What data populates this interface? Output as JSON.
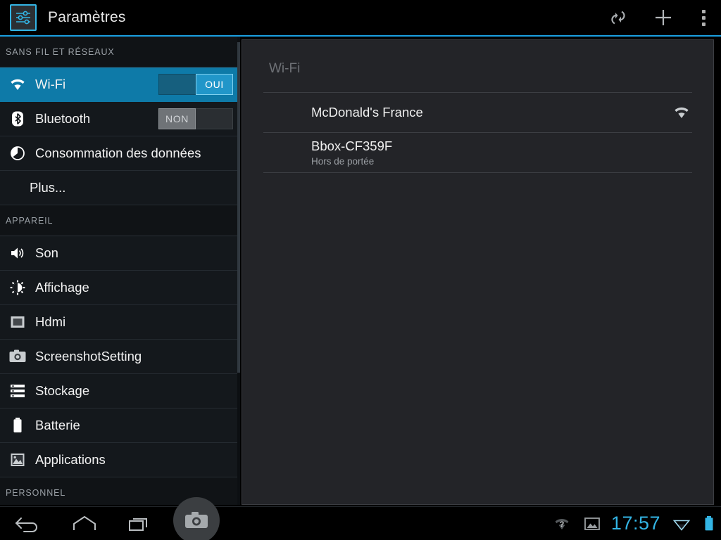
{
  "app": {
    "title": "Paramètres",
    "icon": "settings-sliders-icon",
    "accent_color": "#33b5e5",
    "selected_row_color": "#0e7aa8"
  },
  "action_bar": {
    "buttons": [
      {
        "name": "scan-refresh-button",
        "icon": "refresh-scan-icon",
        "label": ""
      },
      {
        "name": "add-network-button",
        "icon": "plus-icon",
        "label": ""
      },
      {
        "name": "overflow-menu-button",
        "icon": "overflow-menu-icon",
        "label": ""
      }
    ]
  },
  "sidebar": {
    "sections": [
      {
        "header": "SANS FIL ET RÉSEAUX",
        "items": [
          {
            "label": "Wi-Fi",
            "icon": "wifi-icon",
            "selected": true,
            "toggle": {
              "state": "on",
              "label": "OUI"
            }
          },
          {
            "label": "Bluetooth",
            "icon": "bluetooth-icon",
            "selected": false,
            "toggle": {
              "state": "off",
              "label": "NON"
            }
          },
          {
            "label": "Consommation des données",
            "icon": "data-usage-pie-icon",
            "selected": false
          },
          {
            "label": "Plus...",
            "icon": "",
            "selected": false
          }
        ]
      },
      {
        "header": "APPAREIL",
        "items": [
          {
            "label": "Son",
            "icon": "speaker-volume-icon",
            "selected": false
          },
          {
            "label": "Affichage",
            "icon": "brightness-sun-icon",
            "selected": false
          },
          {
            "label": "Hdmi",
            "icon": "monitor-icon",
            "selected": false
          },
          {
            "label": "ScreenshotSetting",
            "icon": "camera-icon",
            "selected": false
          },
          {
            "label": "Stockage",
            "icon": "storage-list-icon",
            "selected": false
          },
          {
            "label": "Batterie",
            "icon": "battery-icon",
            "selected": false
          },
          {
            "label": "Applications",
            "icon": "apps-image-icon",
            "selected": false
          }
        ]
      },
      {
        "header": "PERSONNEL",
        "items": []
      }
    ]
  },
  "main": {
    "title": "Wi-Fi",
    "networks": [
      {
        "name": "McDonald's France",
        "status": "",
        "signal_icon": "wifi-signal-icon",
        "has_signal": true
      },
      {
        "name": "Bbox-CF359F",
        "status": "Hors de portée",
        "signal_icon": "",
        "has_signal": false
      }
    ]
  },
  "system_bar": {
    "buttons": [
      {
        "name": "back-button",
        "icon": "back-arrow-icon"
      },
      {
        "name": "home-button",
        "icon": "home-icon"
      },
      {
        "name": "recents-button",
        "icon": "recent-apps-icon"
      },
      {
        "name": "screenshot-button",
        "icon": "camera-icon"
      }
    ],
    "status": {
      "wifi_unknown_icon": "wifi-question-icon",
      "screenshot_notification_icon": "image-icon",
      "clock": "17:57",
      "wifi_icon": "wifi-signal-icon",
      "battery_icon": "battery-full-icon",
      "clock_color": "#33b5e5"
    }
  }
}
